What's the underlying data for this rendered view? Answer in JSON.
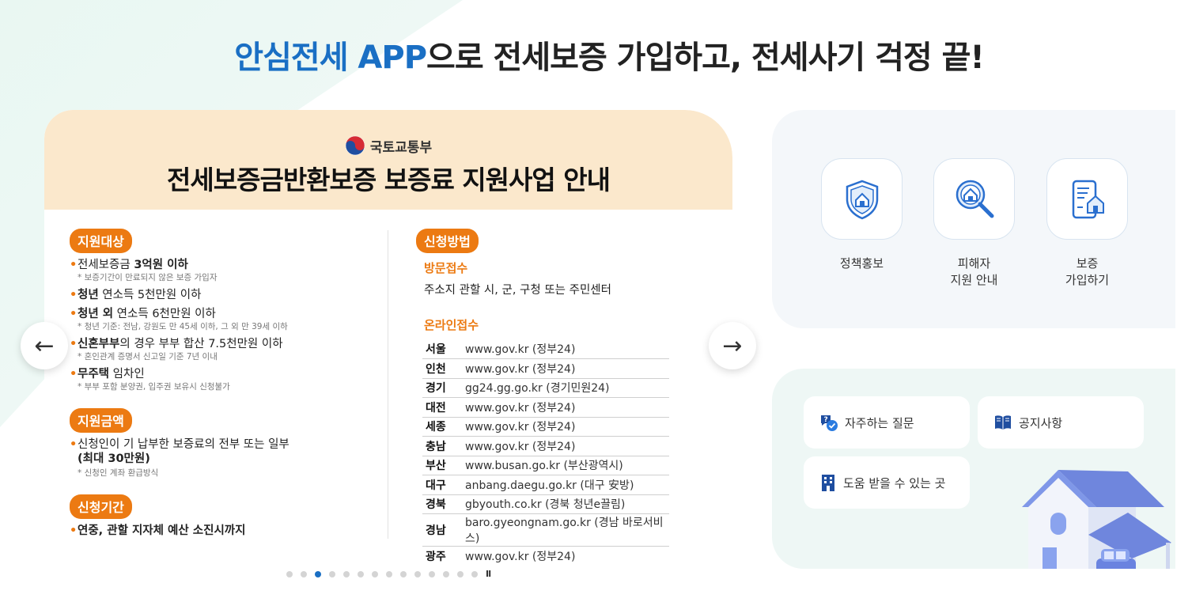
{
  "headline": {
    "accent": "안심전세 APP",
    "rest": "으로 전세보증 가입하고, 전세사기 걱정 끝!"
  },
  "banner": {
    "ministry": "국토교통부",
    "title": "전세보증금반환보증 보증료 지원사업 안내",
    "target": {
      "pill": "지원대상",
      "items": [
        {
          "strong_pre": "",
          "text_pre": "전세보증금 ",
          "strong": "3억원 이하",
          "text": "",
          "note": "* 보증기간이 만료되지 않은 보증 가입자"
        },
        {
          "text_pre": "",
          "strong": "청년",
          "text": " 연소득 5천만원 이하",
          "note": ""
        },
        {
          "text_pre": "",
          "strong": "청년 외",
          "text": " 연소득 6천만원 이하",
          "note": "* 청년 기준: 전남, 강원도 만 45세 이하, 그 외 만 39세 이하"
        },
        {
          "text_pre": "",
          "strong": "신혼부부",
          "text": "의 경우 부부 합산 7.5천만원 이하",
          "note": "* 혼인관계 증명서 신고일 기준 7년 이내"
        },
        {
          "text_pre": "",
          "strong": "무주택",
          "text": " 임차인",
          "note": "* 부부 포함 분양권, 입주권 보유시 신청불가"
        }
      ]
    },
    "amount": {
      "pill": "지원금액",
      "line1": "신청인이 기 납부한 보증료의 전부 또는 일부",
      "line2": "(최대 30만원)",
      "note": "* 신청인 계좌 환급방식"
    },
    "period": {
      "pill": "신청기간",
      "text": "연중, 관할 지자체 예산 소진시까지"
    },
    "method": {
      "pill": "신청방법",
      "visit_head": "방문접수",
      "visit_text": "주소지 관할 시, 군, 구청 또는 주민센터",
      "online_head": "온라인접수",
      "regions": [
        {
          "name": "서울",
          "site": "www.gov.kr (정부24)"
        },
        {
          "name": "인천",
          "site": "www.gov.kr (정부24)"
        },
        {
          "name": "경기",
          "site": "gg24.gg.go.kr (경기민원24)"
        },
        {
          "name": "대전",
          "site": "www.gov.kr (정부24)"
        },
        {
          "name": "세종",
          "site": "www.gov.kr (정부24)"
        },
        {
          "name": "충남",
          "site": "www.gov.kr (정부24)"
        },
        {
          "name": "부산",
          "site": "www.busan.go.kr (부산광역시)"
        },
        {
          "name": "대구",
          "site": "anbang.daegu.go.kr (대구 安방)"
        },
        {
          "name": "경북",
          "site": "gbyouth.co.kr (경북 청년e끌림)"
        },
        {
          "name": "경남",
          "site": "baro.gyeongnam.go.kr (경남 바로서비스)"
        },
        {
          "name": "광주",
          "site": "www.gov.kr (정부24)"
        }
      ]
    }
  },
  "nav": {
    "prev": "←",
    "next": "→",
    "pause": "II"
  },
  "carousel": {
    "total": 14,
    "active_index": 2
  },
  "services": [
    {
      "label": "정책홍보",
      "icon": "shield-house-icon"
    },
    {
      "label": "피해자\n지원 안내",
      "icon": "magnifier-house-icon"
    },
    {
      "label": "보증\n가입하기",
      "icon": "phone-house-icon"
    }
  ],
  "quick": [
    {
      "label": "자주하는 질문",
      "icon": "faq-chat-icon"
    },
    {
      "label": "공지사항",
      "icon": "book-icon"
    },
    {
      "label": "도움 받을 수 있는 곳",
      "icon": "building-icon"
    }
  ],
  "colors": {
    "accent_blue": "#1a6fc4",
    "accent_orange": "#ec7a12",
    "banner_head": "#fbe8cc"
  }
}
